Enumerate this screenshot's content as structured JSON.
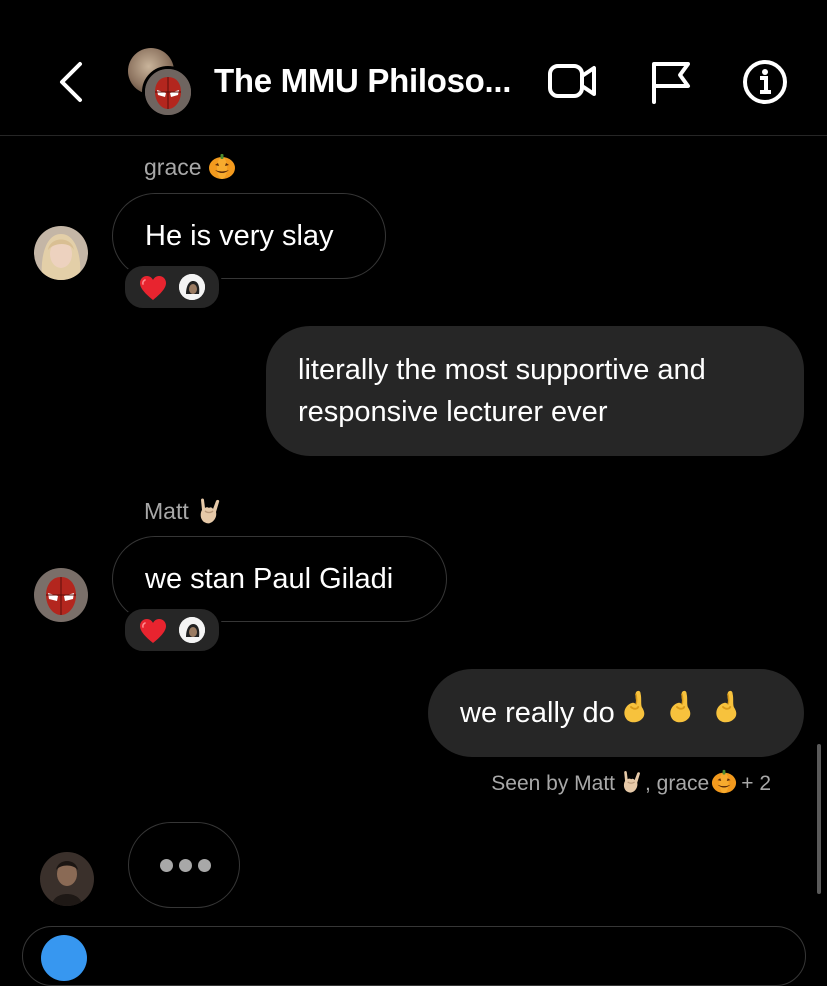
{
  "header": {
    "title": "The MMU Philoso...",
    "icons": [
      "back-chevron-icon",
      "video-call-icon",
      "flag-icon",
      "info-icon"
    ]
  },
  "messages": [
    {
      "sender": "grace",
      "sender_emoji": "jack-o-lantern",
      "direction": "incoming",
      "text": "He is very slay",
      "reactions": [
        "red-heart",
        "user-avatar"
      ]
    },
    {
      "direction": "outgoing",
      "text_lines": [
        "literally the most supportive and",
        "responsive lecturer ever"
      ]
    },
    {
      "sender": "Matt",
      "sender_emoji": "sign-of-the-horns",
      "direction": "incoming",
      "text": "we stan Paul Giladi",
      "reactions": [
        "red-heart",
        "user-avatar"
      ]
    },
    {
      "direction": "outgoing",
      "text": "we really do",
      "trailing_emojis": [
        "pinched-fingers",
        "pinched-fingers",
        "pinched-fingers"
      ]
    }
  ],
  "seen": {
    "prefix": "Seen by Matt",
    "grace": ", grace",
    "more": " + 2"
  },
  "typing": {
    "indicator": "typing-dots"
  },
  "colors": {
    "background": "#000000",
    "outgoing_bubble": "#262626",
    "incoming_border": "#363636",
    "secondary_text": "#a8a8a8",
    "accent": "#3797f0"
  }
}
